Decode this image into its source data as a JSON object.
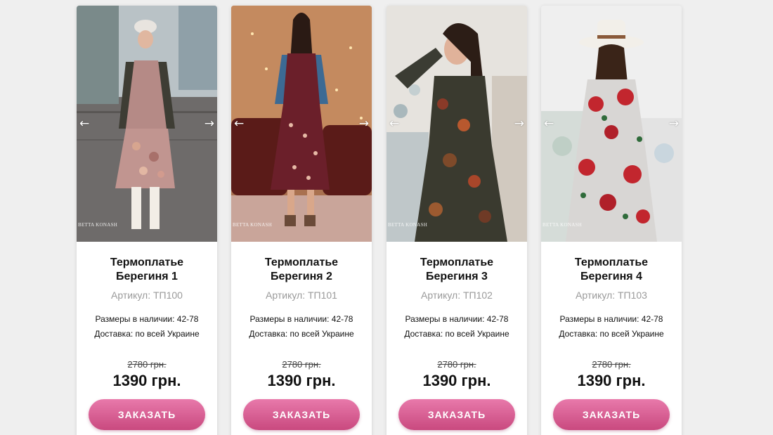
{
  "colors": {
    "page_background": "#efefef",
    "card_background": "#ffffff",
    "button_gradient_top": "#e879ab",
    "button_gradient_bottom": "#c9497f",
    "article_text": "#9a9a9a"
  },
  "slider": {
    "prev_icon": "←",
    "next_icon": "→"
  },
  "products": [
    {
      "title_line1": "Термоплатье",
      "title_line2": "Берегиня 1",
      "article": "Артикул: ТП100",
      "sizes": "Размеры в наличии: 42-78",
      "delivery": "Доставка: по всей Украине",
      "old_price": "2780 грн.",
      "new_price": "1390 грн.",
      "button_label": "ЗАКАЗАТЬ",
      "watermark": "BETTA KONASH"
    },
    {
      "title_line1": "Термоплатье",
      "title_line2": "Берегиня 2",
      "article": "Артикул: ТП101",
      "sizes": "Размеры в наличии: 42-78",
      "delivery": "Доставка: по всей Украине",
      "old_price": "2780 грн.",
      "new_price": "1390 грн.",
      "button_label": "ЗАКАЗАТЬ",
      "watermark": "BETTA KONASH"
    },
    {
      "title_line1": "Термоплатье",
      "title_line2": "Берегиня 3",
      "article": "Артикул: ТП102",
      "sizes": "Размеры в наличии: 42-78",
      "delivery": "Доставка: по всей Украине",
      "old_price": "2780 грн.",
      "new_price": "1390 грн.",
      "button_label": "ЗАКАЗАТЬ",
      "watermark": "BETTA KONASH"
    },
    {
      "title_line1": "Термоплатье",
      "title_line2": "Берегиня 4",
      "article": "Артикул: ТП103",
      "sizes": "Размеры в наличии: 42-78",
      "delivery": "Доставка: по всей Украине",
      "old_price": "2780 грн.",
      "new_price": "1390 грн.",
      "button_label": "ЗАКАЗАТЬ",
      "watermark": "BETTA KONASH"
    }
  ]
}
